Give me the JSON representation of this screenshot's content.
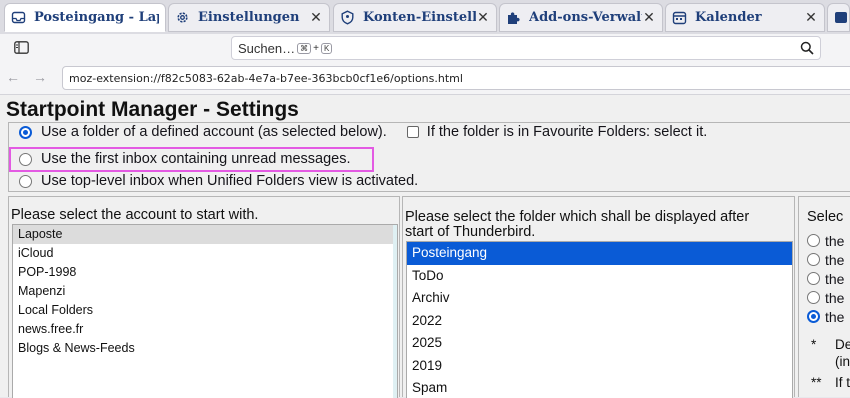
{
  "tabs": [
    {
      "label": "Posteingang - Laposte",
      "icon": "inbox-icon"
    },
    {
      "label": "Einstellungen",
      "icon": "gear-icon"
    },
    {
      "label": "Konten-Einstellungen",
      "icon": "account-shield-icon"
    },
    {
      "label": "Add-ons-Verwaltung",
      "icon": "puzzle-icon"
    },
    {
      "label": "Kalender",
      "icon": "calendar-icon"
    }
  ],
  "toolbar": {
    "search_placeholder": "Suchen…",
    "shortcut_cmd": "⌘",
    "shortcut_plus": "+",
    "shortcut_key": "K"
  },
  "nav": {
    "back": "←",
    "forward": "→",
    "url": "moz-extension://f82c5083-62ab-4e7a-b7ee-363bcb0cf1e6/options.html"
  },
  "page": {
    "title": "Startpoint Manager - Settings",
    "options": [
      {
        "label": "Use a folder of a defined account (as selected below).",
        "selected": true
      },
      {
        "label": "Use the first inbox containing unread messages.",
        "selected": false
      },
      {
        "label": "Use top-level inbox when Unified Folders view is activated.",
        "selected": false
      }
    ],
    "favourite_checkbox_label": "If the folder is in Favourite Folders: select it."
  },
  "accounts_panel": {
    "title": "Please select the account to start with.",
    "accounts": [
      "Laposte",
      "iCloud",
      "POP-1998",
      "Mapenzi",
      "Local Folders",
      "news.free.fr",
      "Blogs & News-Feeds"
    ],
    "selected_index": 0
  },
  "folders_panel": {
    "title_line1": "Please select the folder which shall be displayed after",
    "title_line2": "start of Thunderbird.",
    "folders": [
      "Posteingang",
      "ToDo",
      "Archiv",
      "2022",
      "2025",
      "2019",
      "Spam"
    ],
    "selected_index": 0
  },
  "right_panel": {
    "title": "Selec",
    "options": [
      "the",
      "the",
      "the",
      "the",
      "the"
    ],
    "selected_index": 4,
    "notes": [
      {
        "marker": "*",
        "line1": "De",
        "line2": "(in"
      },
      {
        "marker": "**",
        "line1": "If t",
        "line2": ""
      }
    ]
  },
  "colors": {
    "accent": "#0a5bd6",
    "highlight": "#e35ae3",
    "tab_text": "#1f3f7a"
  }
}
